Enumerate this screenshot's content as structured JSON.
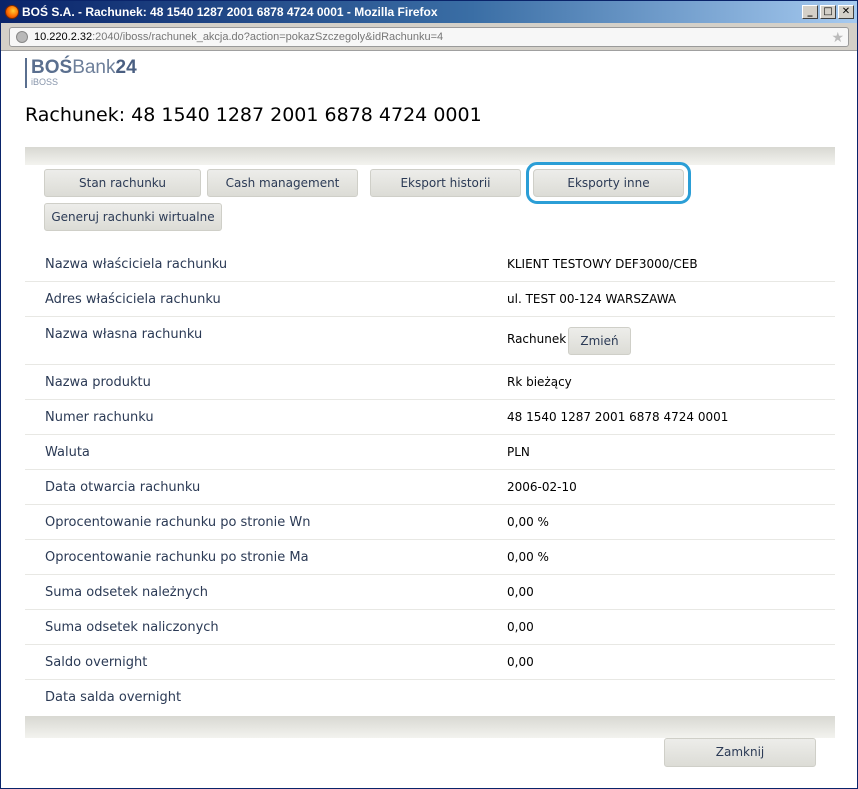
{
  "window": {
    "title": "BOŚ S.A. - Rachunek: 48 1540 1287 2001 6878 4724 0001 - Mozilla Firefox",
    "minimize": "_",
    "maximize": "□",
    "close": "✕"
  },
  "address": {
    "host": "10.220.2.32",
    "path": ":2040/iboss/rachunek_akcja.do?action=pokazSzczegoly&idRachunku=4"
  },
  "logo": {
    "brand_bold": "BOŚ",
    "brand_rest": "Bank",
    "brand_num": "24",
    "sub": "iBOSS"
  },
  "page": {
    "title": "Rachunek: 48 1540 1287 2001 6878 4724 0001"
  },
  "tabs": [
    {
      "label": "Stan rachunku"
    },
    {
      "label": "Cash management"
    },
    {
      "label": "Eksport historii"
    },
    {
      "label": "Eksporty inne",
      "active": true
    },
    {
      "label": "Generuj rachunki wirtualne"
    }
  ],
  "details": [
    {
      "label": "Nazwa właściciela rachunku",
      "value": "KLIENT TESTOWY DEF3000/CEB"
    },
    {
      "label": "Adres właściciela rachunku",
      "value": "ul. TEST 00-124 WARSZAWA"
    },
    {
      "label": "Nazwa własna rachunku",
      "value": "Rachunek",
      "button": "Zmień"
    },
    {
      "label": "Nazwa produktu",
      "value": "Rk bieżący"
    },
    {
      "label": "Numer rachunku",
      "value": "48 1540 1287 2001 6878 4724 0001"
    },
    {
      "label": "Waluta",
      "value": "PLN"
    },
    {
      "label": "Data otwarcia rachunku",
      "value": "2006-02-10"
    },
    {
      "label": "Oprocentowanie rachunku po stronie Wn",
      "value": "0,00 %"
    },
    {
      "label": "Oprocentowanie rachunku po stronie Ma",
      "value": "0,00 %"
    },
    {
      "label": "Suma odsetek należnych",
      "value": "0,00"
    },
    {
      "label": "Suma odsetek naliczonych",
      "value": "0,00"
    },
    {
      "label": "Saldo overnight",
      "value": "0,00"
    },
    {
      "label": "Data salda overnight",
      "value": ""
    }
  ],
  "footer": {
    "close_label": "Zamknij"
  },
  "colors": {
    "accent_outline": "#2b9ed6",
    "label_text": "#2b3a55",
    "titlebar": "#0a246a"
  }
}
